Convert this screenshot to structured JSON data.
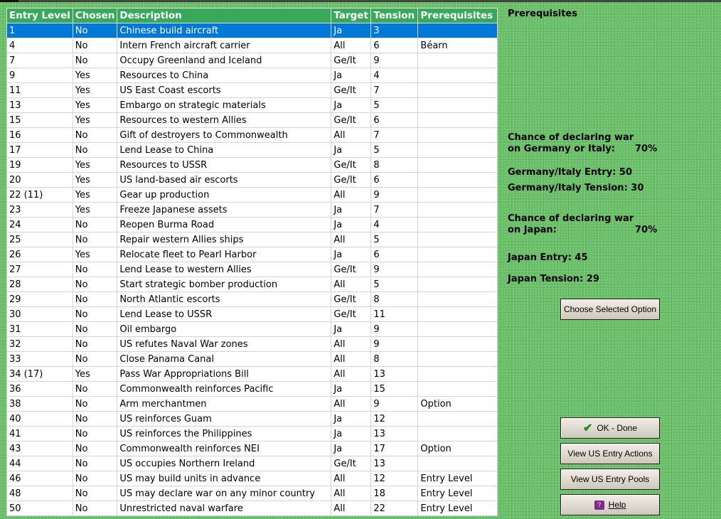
{
  "columns": [
    "Entry Level",
    "Chosen",
    "Description",
    "Target",
    "Tension",
    "Prerequisites"
  ],
  "rows": [
    [
      "1",
      "No",
      "Chinese build aircraft",
      "Ja",
      "3",
      ""
    ],
    [
      "4",
      "No",
      "Intern French aircraft carrier",
      "All",
      "6",
      "Béarn"
    ],
    [
      "7",
      "No",
      "Occupy Greenland and Iceland",
      "Ge/It",
      "9",
      ""
    ],
    [
      "9",
      "Yes",
      "Resources to China",
      "Ja",
      "4",
      ""
    ],
    [
      "11",
      "Yes",
      "US East Coast escorts",
      "Ge/It",
      "7",
      ""
    ],
    [
      "13",
      "Yes",
      "Embargo on strategic materials",
      "Ja",
      "5",
      ""
    ],
    [
      "15",
      "Yes",
      "Resources to western Allies",
      "Ge/It",
      "6",
      ""
    ],
    [
      "16",
      "No",
      "Gift of destroyers to Commonwealth",
      "All",
      "7",
      ""
    ],
    [
      "17",
      "No",
      "Lend Lease to China",
      "Ja",
      "5",
      ""
    ],
    [
      "19",
      "Yes",
      "Resources to USSR",
      "Ge/It",
      "8",
      ""
    ],
    [
      "20",
      "Yes",
      "US land-based air escorts",
      "Ge/It",
      "6",
      ""
    ],
    [
      "22 (11)",
      "Yes",
      "Gear up production",
      "All",
      "9",
      ""
    ],
    [
      "23",
      "Yes",
      "Freeze Japanese assets",
      "Ja",
      "7",
      ""
    ],
    [
      "24",
      "No",
      "Reopen Burma Road",
      "Ja",
      "4",
      ""
    ],
    [
      "25",
      "No",
      "Repair western Allies ships",
      "All",
      "5",
      ""
    ],
    [
      "26",
      "Yes",
      "Relocate fleet to Pearl Harbor",
      "Ja",
      "6",
      ""
    ],
    [
      "27",
      "No",
      "Lend Lease to western Allies",
      "Ge/It",
      "9",
      ""
    ],
    [
      "28",
      "No",
      "Start strategic bomber production",
      "All",
      "5",
      ""
    ],
    [
      "29",
      "No",
      "North Atlantic escorts",
      "Ge/It",
      "8",
      ""
    ],
    [
      "30",
      "No",
      "Lend Lease to USSR",
      "Ge/It",
      "11",
      ""
    ],
    [
      "31",
      "No",
      "Oil embargo",
      "Ja",
      "9",
      ""
    ],
    [
      "32",
      "No",
      "US refutes Naval War zones",
      "All",
      "9",
      ""
    ],
    [
      "33",
      "No",
      "Close Panama Canal",
      "All",
      "8",
      ""
    ],
    [
      "34 (17)",
      "Yes",
      "Pass War Appropriations Bill",
      "All",
      "13",
      ""
    ],
    [
      "36",
      "No",
      "Commonwealth reinforces Pacific",
      "Ja",
      "15",
      ""
    ],
    [
      "38",
      "No",
      "Arm merchantmen",
      "All",
      "9",
      "Option"
    ],
    [
      "40",
      "No",
      "US reinforces Guam",
      "Ja",
      "12",
      ""
    ],
    [
      "41",
      "No",
      "US reinforces the Philippines",
      "Ja",
      "13",
      ""
    ],
    [
      "43",
      "No",
      "Commonwealth reinforces NEI",
      "Ja",
      "17",
      "Option"
    ],
    [
      "44",
      "No",
      "US occupies Northern Ireland",
      "Ge/It",
      "13",
      ""
    ],
    [
      "46",
      "No",
      "US may build units in advance",
      "All",
      "12",
      "Entry Level"
    ],
    [
      "48",
      "No",
      "US may declare war on any minor country",
      "All",
      "18",
      "Entry Level"
    ],
    [
      "50",
      "No",
      "Unrestricted naval warfare",
      "All",
      "22",
      "Entry Level"
    ]
  ],
  "selected_row": 0,
  "panel": {
    "prereq_title": "Prerequisites",
    "ge_chance_1": "Chance of declaring war",
    "ge_chance_2": "on Germany or Italy:",
    "ge_chance_val": "70%",
    "ge_entry": "Germany/Italy Entry: 50",
    "ge_tension": "Germany/Italy Tension: 30",
    "ja_chance_1": "Chance of declaring war",
    "ja_chance_2": "on Japan:",
    "ja_chance_val": "70%",
    "ja_entry": "Japan Entry: 45",
    "ja_tension": "Japan Tension: 29"
  },
  "buttons": {
    "choose": "Choose Selected Option",
    "ok": "OK - Done",
    "actions": "View US Entry Actions",
    "pools": "View US Entry Pools",
    "help": "Help"
  }
}
